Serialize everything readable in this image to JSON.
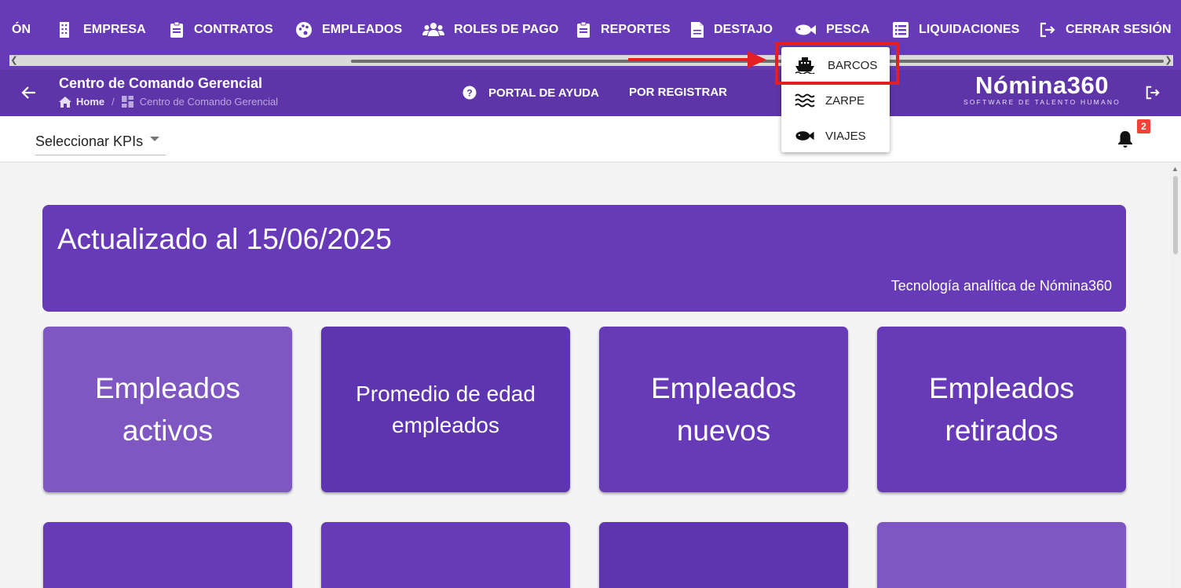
{
  "nav": {
    "items": [
      {
        "label": "ÓN",
        "icon": "none"
      },
      {
        "label": "EMPRESA",
        "icon": "building-icon"
      },
      {
        "label": "CONTRATOS",
        "icon": "clipboard-icon"
      },
      {
        "label": "EMPLEADOS",
        "icon": "palette-icon"
      },
      {
        "label": "ROLES DE PAGO",
        "icon": "users-icon"
      },
      {
        "label": "REPORTES",
        "icon": "clipboard-icon"
      },
      {
        "label": "DESTAJO",
        "icon": "file-icon"
      },
      {
        "label": "PESCA",
        "icon": "fish-icon"
      },
      {
        "label": "LIQUIDACIONES",
        "icon": "list-icon"
      },
      {
        "label": "CERRAR SESIÓN",
        "icon": "logout-icon"
      }
    ]
  },
  "pesca_menu": {
    "items": [
      {
        "label": "BARCOS",
        "icon": "ship-icon"
      },
      {
        "label": "ZARPE",
        "icon": "waves-icon"
      },
      {
        "label": "VIAJES",
        "icon": "fish-icon"
      }
    ],
    "highlight_color": "#e31e24"
  },
  "header": {
    "title": "Centro de Comando Gerencial",
    "breadcrumb_home": "Home",
    "breadcrumb_current": "Centro de Comando Gerencial",
    "help_label": "PORTAL DE AYUDA",
    "register_label": "POR REGISTRAR",
    "logo_text": "Nómina360",
    "logo_tagline": "SOFTWARE DE TALENTO HUMANO"
  },
  "kpi": {
    "select_label": "Seleccionar KPIs",
    "notification_count": "2"
  },
  "banner": {
    "title": "Actualizado al 15/06/2025",
    "subtitle": "Tecnología analítica de Nómina360"
  },
  "cards": [
    {
      "label": "Empleados activos",
      "color": "#7e57c2"
    },
    {
      "label": "Promedio de edad empleados",
      "color": "#5e35b1"
    },
    {
      "label": "Empleados nuevos",
      "color": "#673ab7"
    },
    {
      "label": "Empleados retirados",
      "color": "#673ab7"
    }
  ],
  "colors": {
    "primary": "#673ab7",
    "subbar": "#5d35a8",
    "badge": "#f44336"
  }
}
